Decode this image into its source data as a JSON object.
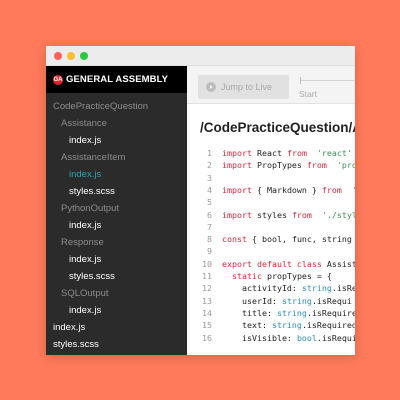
{
  "brand": {
    "name": "GENERAL ASSEMBLY",
    "logo": "GA"
  },
  "sidebar": {
    "items": [
      {
        "label": "CodePracticeQuestion",
        "type": "folder",
        "depth": 0
      },
      {
        "label": "Assistance",
        "type": "folder",
        "depth": 1
      },
      {
        "label": "index.js",
        "type": "file",
        "depth": 2
      },
      {
        "label": "AssistanceItem",
        "type": "folder",
        "depth": 1
      },
      {
        "label": "index.js",
        "type": "file",
        "depth": 2,
        "active": true
      },
      {
        "label": "styles.scss",
        "type": "file",
        "depth": 2
      },
      {
        "label": "PythonOutput",
        "type": "folder",
        "depth": 1
      },
      {
        "label": "index.js",
        "type": "file",
        "depth": 2
      },
      {
        "label": "Response",
        "type": "folder",
        "depth": 1
      },
      {
        "label": "index.js",
        "type": "file",
        "depth": 2
      },
      {
        "label": "styles.scss",
        "type": "file",
        "depth": 2
      },
      {
        "label": "SQLOutput",
        "type": "folder",
        "depth": 1
      },
      {
        "label": "index.js",
        "type": "file",
        "depth": 2
      },
      {
        "label": "index.js",
        "type": "file",
        "depth": 0
      },
      {
        "label": "styles.scss",
        "type": "file",
        "depth": 0
      }
    ]
  },
  "toolbar": {
    "jump_label": "Jump to Live",
    "start_label": "Start"
  },
  "editor": {
    "path": "/CodePracticeQuestion/Assi",
    "lines": [
      {
        "n": "1",
        "tokens": [
          [
            "kw",
            "import"
          ],
          [
            "",
            "React "
          ],
          [
            "kw",
            "from"
          ],
          [
            "str",
            " 'react'"
          ]
        ]
      },
      {
        "n": "2",
        "tokens": [
          [
            "kw",
            "import"
          ],
          [
            "",
            "PropTypes "
          ],
          [
            "kw",
            "from"
          ],
          [
            "str",
            " 'prop"
          ]
        ]
      },
      {
        "n": "3",
        "tokens": []
      },
      {
        "n": "4",
        "tokens": [
          [
            "kw",
            "import"
          ],
          [
            "",
            "{ Markdown } "
          ],
          [
            "kw",
            "from"
          ],
          [
            "str",
            " 'b"
          ]
        ]
      },
      {
        "n": "5",
        "tokens": []
      },
      {
        "n": "6",
        "tokens": [
          [
            "kw",
            "import"
          ],
          [
            "",
            "styles "
          ],
          [
            "kw",
            "from"
          ],
          [
            "str",
            " './style"
          ]
        ]
      },
      {
        "n": "7",
        "tokens": []
      },
      {
        "n": "8",
        "tokens": [
          [
            "kw",
            "const"
          ],
          [
            "",
            "{ bool, func, string "
          ]
        ]
      },
      {
        "n": "9",
        "tokens": []
      },
      {
        "n": "10",
        "tokens": [
          [
            "kw",
            "export default class"
          ],
          [
            "",
            "Assist"
          ]
        ]
      },
      {
        "n": "11",
        "tokens": [
          [
            "",
            "  "
          ],
          [
            "kw",
            "static"
          ],
          [
            "",
            "propTypes = {"
          ]
        ]
      },
      {
        "n": "12",
        "tokens": [
          [
            "",
            "    activityId: "
          ],
          [
            "typ",
            "string"
          ],
          [
            "",
            ".isRe"
          ]
        ]
      },
      {
        "n": "13",
        "tokens": [
          [
            "",
            "    userId: "
          ],
          [
            "typ",
            "string"
          ],
          [
            "",
            ".isRequi"
          ]
        ]
      },
      {
        "n": "14",
        "tokens": [
          [
            "",
            "    title: "
          ],
          [
            "typ",
            "string"
          ],
          [
            "",
            ".isRequire"
          ]
        ]
      },
      {
        "n": "15",
        "tokens": [
          [
            "",
            "    text: "
          ],
          [
            "typ",
            "string"
          ],
          [
            "",
            ".isRequired"
          ]
        ]
      },
      {
        "n": "16",
        "tokens": [
          [
            "",
            "    isVisible: "
          ],
          [
            "typ",
            "bool"
          ],
          [
            "",
            ".isRequi"
          ]
        ]
      }
    ]
  },
  "colors": {
    "background": "#FF7A5A",
    "sidebar": "#2b2b2b",
    "active_file": "#2BA5B0",
    "keyword": "#D7263D",
    "string": "#3E8E5A",
    "type": "#2B8FB8"
  }
}
